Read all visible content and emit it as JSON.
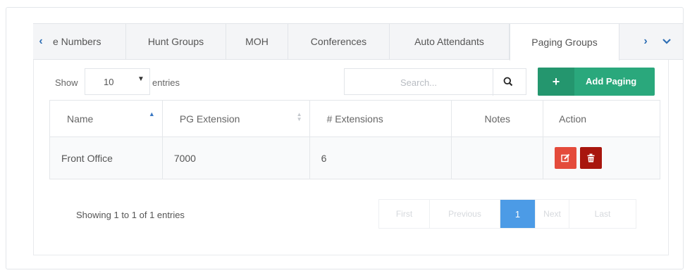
{
  "tabs": [
    {
      "label": "⁠e Numbers",
      "active": false
    },
    {
      "label": "Hunt Groups",
      "active": false
    },
    {
      "label": "MOH",
      "active": false
    },
    {
      "label": "Conferences",
      "active": false
    },
    {
      "label": "Auto Attendants",
      "active": false
    },
    {
      "label": "Paging Groups",
      "active": true
    }
  ],
  "toolbar": {
    "show_label": "Show",
    "entries_value": "10",
    "entries_label": "entries",
    "search_placeholder": "Search...",
    "add_button_label": "Add Paging"
  },
  "table": {
    "headers": [
      "Name",
      "PG Extension",
      "# Extensions",
      "Notes",
      "Action"
    ],
    "rows": [
      {
        "name": "Front Office",
        "pg_extension": "7000",
        "extensions": "6",
        "notes": ""
      }
    ]
  },
  "footer": {
    "info": "Showing 1 to 1 of 1 entries",
    "pagination": {
      "first": "First",
      "previous": "Previous",
      "current": "1",
      "next": "Next",
      "last": "Last"
    }
  },
  "colors": {
    "accent_blue": "#2f6fb5",
    "add_green": "#2aa87c",
    "edit_red": "#e44b3b",
    "delete_dark_red": "#a8160e",
    "page_active": "#4c9be6"
  }
}
